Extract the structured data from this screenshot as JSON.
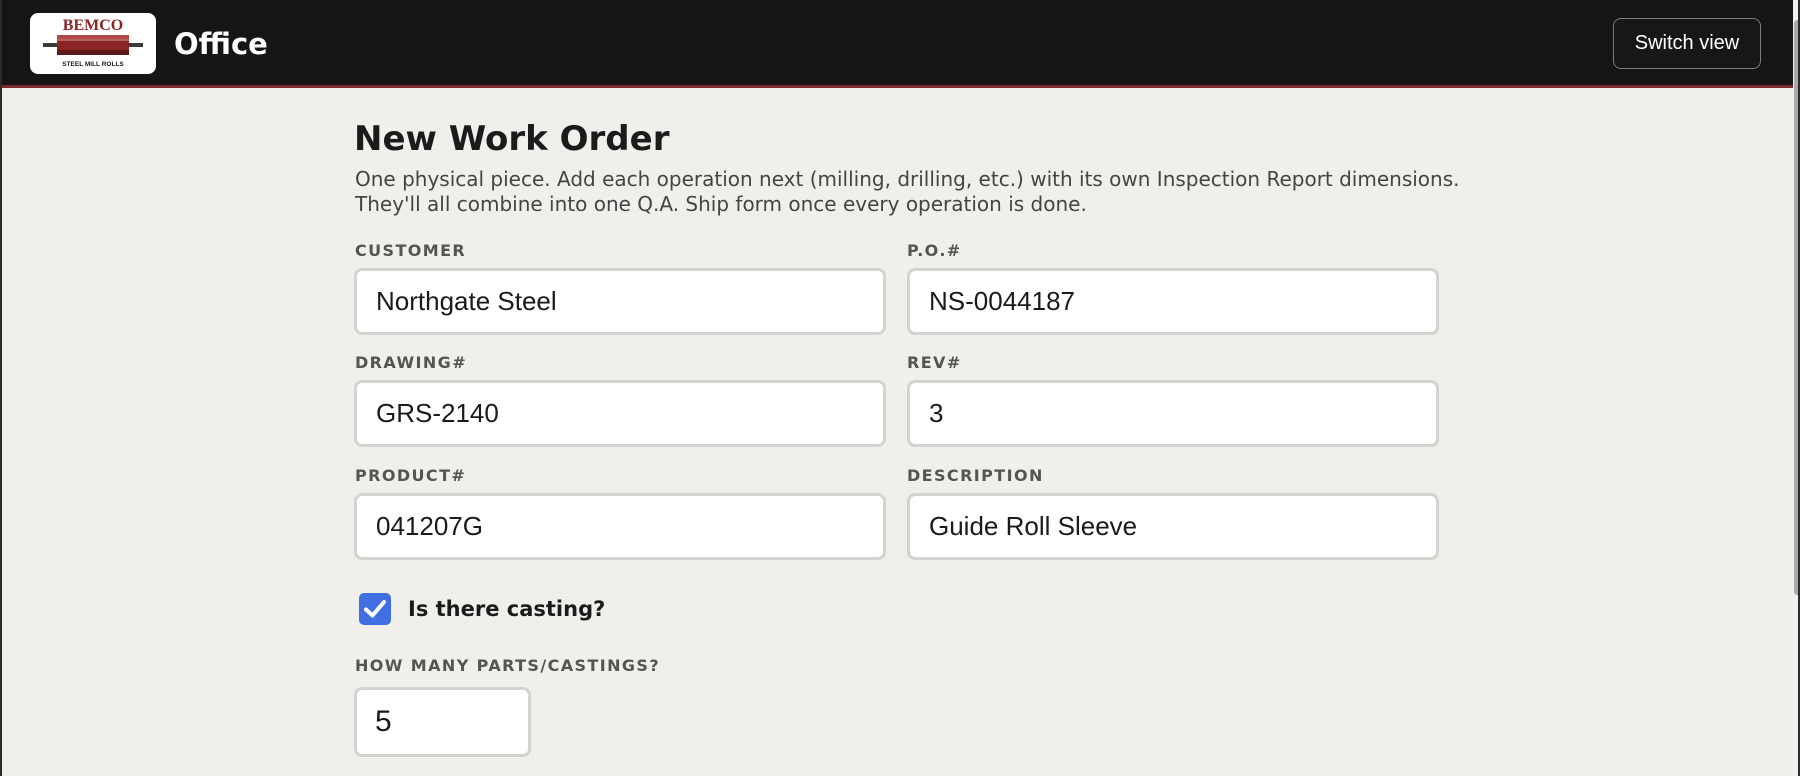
{
  "header": {
    "logo_text": "BEMCO",
    "logo_tagline": "STEEL MILL ROLLS",
    "app_title": "Office",
    "switch_view_label": "Switch view"
  },
  "page": {
    "title": "New Work Order",
    "subtitle_line1": "One physical piece. Add each operation next (milling, drilling, etc.) with its own Inspection Report dimensions.",
    "subtitle_line2": "They'll all combine into one Q.A. Ship form once every operation is done."
  },
  "form": {
    "customer": {
      "label": "CUSTOMER",
      "value": "Northgate Steel"
    },
    "po": {
      "label": "P.O.#",
      "value": "NS-0044187"
    },
    "drawing": {
      "label": "DRAWING#",
      "value": "GRS-2140"
    },
    "rev": {
      "label": "REV#",
      "value": "3"
    },
    "product": {
      "label": "PRODUCT#",
      "value": "041207G"
    },
    "description": {
      "label": "DESCRIPTION",
      "value": "Guide Roll Sleeve"
    },
    "casting": {
      "label": "Is there casting?",
      "checked": true
    },
    "parts_count": {
      "label": "HOW MANY PARTS/CASTINGS?",
      "value": "5"
    }
  },
  "colors": {
    "header_bg": "#161514",
    "accent_line": "#7a2a2a",
    "page_bg": "#f0efec",
    "checkbox_blue": "#3f6fe0",
    "logo_red": "#8b2424"
  }
}
